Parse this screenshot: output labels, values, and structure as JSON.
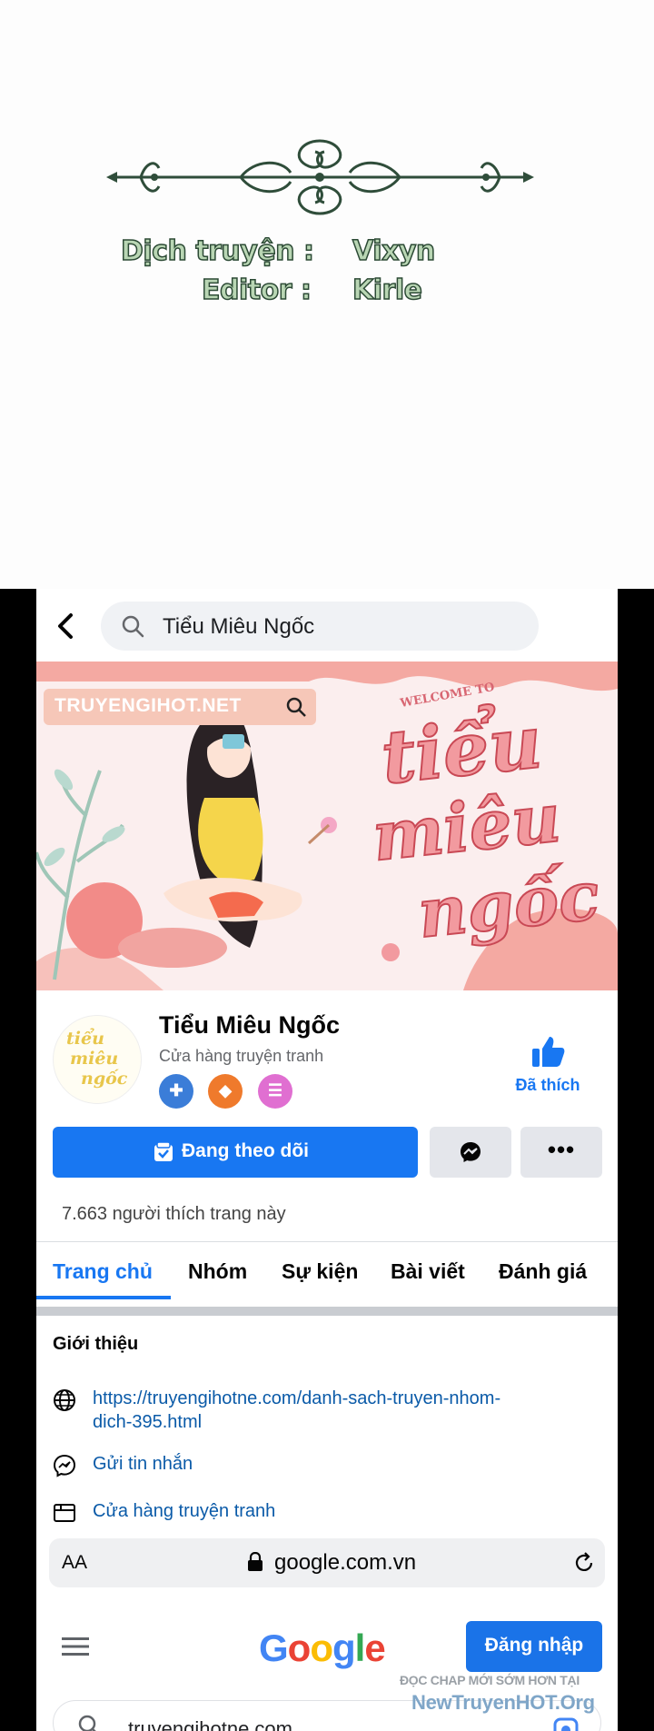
{
  "credits": {
    "translator_label": "Dịch truyện :",
    "translator_name": "Vixyn",
    "editor_label": "Editor :",
    "editor_name": "Kirle"
  },
  "fb": {
    "search_query": "Tiểu Miêu Ngốc",
    "cover": {
      "watermark": "TRUYENGIHOT.NET",
      "welcome": "WELCOME TO",
      "title_line1": "tiểu",
      "title_line2": "miêu",
      "title_line3": "ngốc"
    },
    "avatar_text": [
      "tiểu",
      "miêu",
      "ngốc"
    ],
    "page_name": "Tiểu Miêu Ngốc",
    "page_category": "Cửa hàng truyện tranh",
    "liked_label": "Đã thích",
    "follow_label": "Đang theo dõi",
    "more_label": "•••",
    "likes_count": "7.663 người thích trang này",
    "tabs": [
      "Trang chủ",
      "Nhóm",
      "Sự kiện",
      "Bài viết",
      "Đánh giá"
    ],
    "intro_title": "Giới thiệu",
    "website_line1": "https://truyengihotne.com/danh-sach-truyen-nhom-",
    "website_line2": "dich-395.html",
    "send_message": "Gửi tin nhắn",
    "shop_category": "Cửa hàng truyện tranh"
  },
  "browser": {
    "aa": "AA",
    "url": "google.com.vn"
  },
  "google": {
    "logo_letters": [
      "G",
      "o",
      "o",
      "g",
      "l",
      "e"
    ],
    "logo_colors": [
      "#4285f4",
      "#ea4335",
      "#fbbc05",
      "#4285f4",
      "#34a853",
      "#ea4335"
    ],
    "signin_label": "Đăng nhập",
    "search_text": "truyengihotne.com"
  },
  "watermark": {
    "line1": "ĐỌC CHAP MỚI SỚM HƠN TẠI",
    "line2": "NewTruyenHOT.Org"
  },
  "colors": {
    "fb_blue": "#1877f2",
    "credit_fill": "#b9d6b4",
    "credit_outline": "#2c4a35"
  }
}
